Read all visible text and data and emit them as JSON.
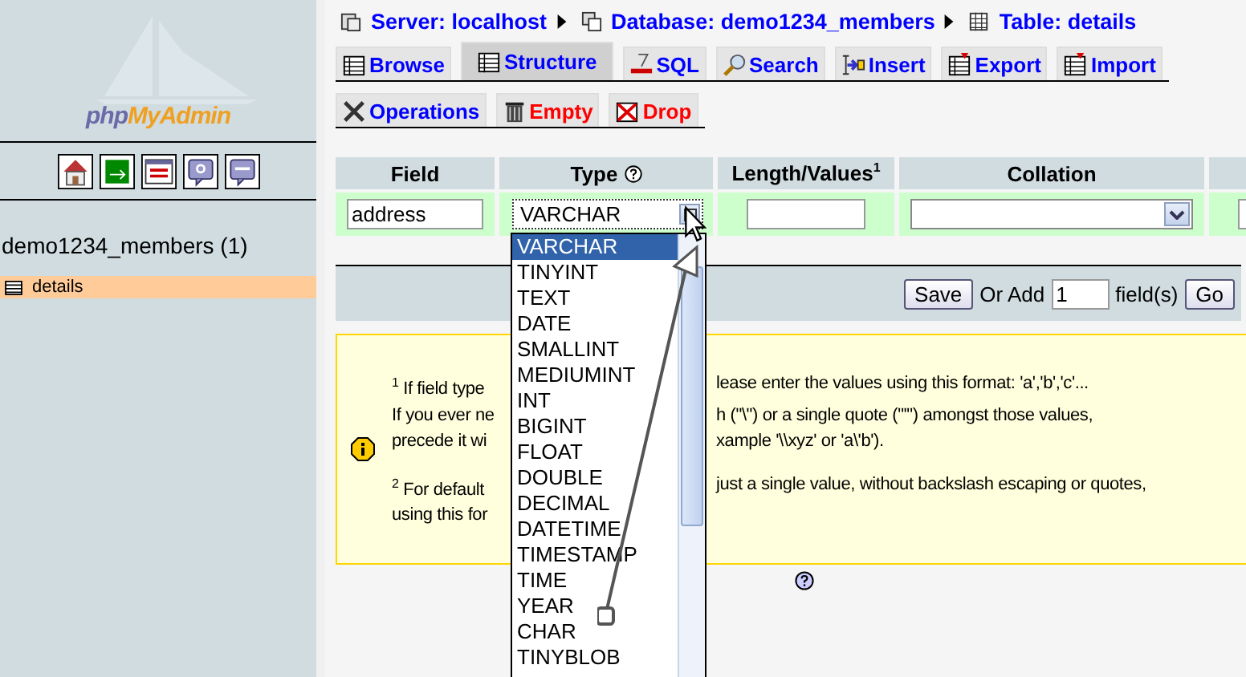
{
  "sidebar": {
    "logo": {
      "prefix": "php",
      "suffix": "MyAdmin"
    },
    "database": "demo1234_members (1)",
    "tables": [
      {
        "label": "details",
        "selected": true
      }
    ]
  },
  "breadcrumb": [
    {
      "kind": "server",
      "label": "Server: localhost"
    },
    {
      "kind": "database",
      "label": "Database: demo1234_members"
    },
    {
      "kind": "table",
      "label": "Table: details"
    }
  ],
  "tab_rows": [
    [
      {
        "kind": "browse",
        "label": "Browse",
        "selected": false,
        "danger": false
      },
      {
        "kind": "structure",
        "label": "Structure",
        "selected": true,
        "danger": false
      },
      {
        "kind": "sql",
        "label": "SQL",
        "selected": false,
        "danger": false
      },
      {
        "kind": "search",
        "label": "Search",
        "selected": false,
        "danger": false
      },
      {
        "kind": "insert",
        "label": "Insert",
        "selected": false,
        "danger": false
      },
      {
        "kind": "export",
        "label": "Export",
        "selected": false,
        "danger": false
      },
      {
        "kind": "import",
        "label": "Import",
        "selected": false,
        "danger": false
      }
    ],
    [
      {
        "kind": "operations",
        "label": "Operations",
        "selected": false,
        "danger": false
      },
      {
        "kind": "empty",
        "label": "Empty",
        "selected": false,
        "danger": true
      },
      {
        "kind": "drop",
        "label": "Drop",
        "selected": false,
        "danger": true
      }
    ]
  ],
  "table": {
    "columns": [
      {
        "label": "Field",
        "help": false
      },
      {
        "label": "Type",
        "help": true
      },
      {
        "label": "Length/Values$^{1}$",
        "help": false
      },
      {
        "label": "Collation",
        "help": false
      }
    ],
    "row": {
      "field": "address",
      "type": "VARCHAR"
    }
  },
  "type_dropdown": {
    "options": [
      {
        "label": "VARCHAR",
        "selected": true
      },
      {
        "label": "TINYINT",
        "selected": false
      },
      {
        "label": "TEXT",
        "selected": false
      },
      {
        "label": "DATE",
        "selected": false
      },
      {
        "label": "SMALLINT",
        "selected": false
      },
      {
        "label": "MEDIUMINT",
        "selected": false
      },
      {
        "label": "INT",
        "selected": false
      },
      {
        "label": "BIGINT",
        "selected": false
      },
      {
        "label": "FLOAT",
        "selected": false
      },
      {
        "label": "DOUBLE",
        "selected": false
      },
      {
        "label": "DECIMAL",
        "selected": false
      },
      {
        "label": "DATETIME",
        "selected": false
      },
      {
        "label": "TIMESTAMP",
        "selected": false
      },
      {
        "label": "TIME",
        "selected": false
      },
      {
        "label": "YEAR",
        "selected": false
      },
      {
        "label": "CHAR",
        "selected": false
      },
      {
        "label": "TINYBLOB",
        "selected": false
      }
    ]
  },
  "actions": {
    "save": "Save",
    "or_add": "Or Add",
    "count": "1",
    "fields": "field(s)",
    "go": "Go"
  },
  "note": {
    "paragraphs": [
      {
        "lines": [
          {
            "left": "$^{1}$ If field type",
            "right": "lease enter the values using this format: 'a','b','c'..."
          },
          {
            "left": "If you ever ne",
            "right": "h (\"\\\") or a single quote (\"'\") amongst those values,"
          },
          {
            "left": "precede it wi",
            "right": "xample '\\\\xyz' or 'a\\'b')."
          }
        ]
      },
      {
        "lines": [
          {
            "left": "$^{2}$ For default",
            "right": "just a single value, without backslash escaping or quotes,"
          },
          {
            "left": "using this for"
          }
        ]
      }
    ]
  }
}
